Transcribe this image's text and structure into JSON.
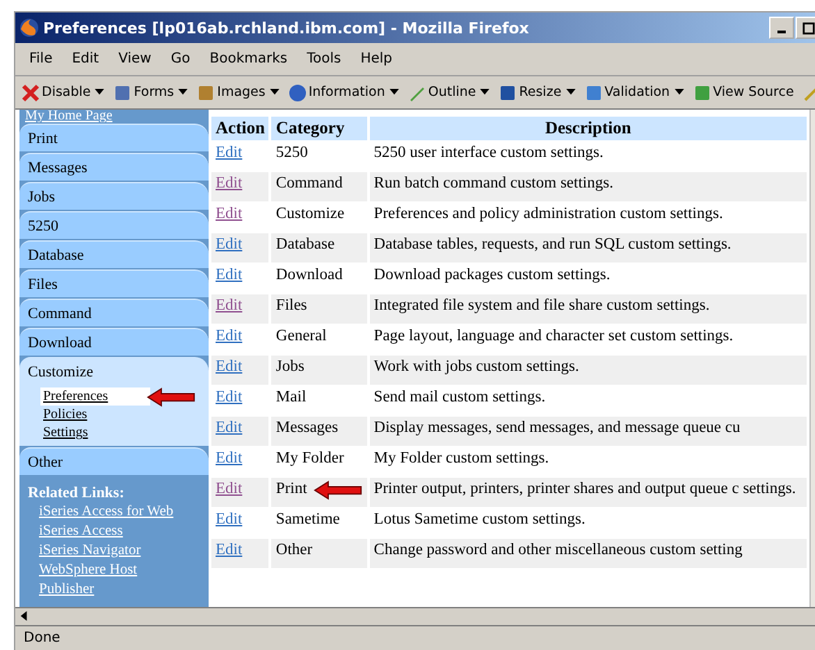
{
  "window": {
    "title": "Preferences [lp016ab.rchland.ibm.com] - Mozilla Firefox"
  },
  "menu": [
    "File",
    "Edit",
    "View",
    "Go",
    "Bookmarks",
    "Tools",
    "Help"
  ],
  "toolbar": [
    {
      "label": "Disable",
      "has_menu": true,
      "kind": "disable"
    },
    {
      "label": "Forms",
      "has_menu": true,
      "kind": "forms"
    },
    {
      "label": "Images",
      "has_menu": true,
      "kind": "images"
    },
    {
      "label": "Information",
      "has_menu": true,
      "kind": "info"
    },
    {
      "label": "Outline",
      "has_menu": true,
      "kind": "outline"
    },
    {
      "label": "Resize",
      "has_menu": true,
      "kind": "resize"
    },
    {
      "label": "Validation",
      "has_menu": true,
      "kind": "validation"
    },
    {
      "label": "View Source",
      "has_menu": false,
      "kind": "source"
    }
  ],
  "sidebar": {
    "home_link": "My Home Page",
    "tabs": [
      {
        "label": "Print",
        "selected": false
      },
      {
        "label": "Messages",
        "selected": false
      },
      {
        "label": "Jobs",
        "selected": false
      },
      {
        "label": "5250",
        "selected": false
      },
      {
        "label": "Database",
        "selected": false
      },
      {
        "label": "Files",
        "selected": false
      },
      {
        "label": "Command",
        "selected": false
      },
      {
        "label": "Download",
        "selected": false
      },
      {
        "label": "Customize",
        "selected": true,
        "children": [
          {
            "label": "Preferences",
            "selected": true
          },
          {
            "label": "Policies",
            "selected": false
          },
          {
            "label": "Settings",
            "selected": false
          }
        ]
      },
      {
        "label": "Other",
        "selected": false
      }
    ],
    "related_heading": "Related Links:",
    "related_links": [
      "iSeries Access for Web",
      "iSeries Access",
      "iSeries Navigator",
      "WebSphere Host",
      "Publisher"
    ]
  },
  "table": {
    "columns": [
      "Action",
      "Category",
      "Description"
    ],
    "rows": [
      {
        "action": "Edit",
        "visited": false,
        "category": "5250",
        "description": "5250 user interface custom settings."
      },
      {
        "action": "Edit",
        "visited": true,
        "category": "Command",
        "description": "Run batch command custom settings."
      },
      {
        "action": "Edit",
        "visited": true,
        "category": "Customize",
        "description": "Preferences and policy administration custom settings."
      },
      {
        "action": "Edit",
        "visited": false,
        "category": "Database",
        "description": "Database tables, requests, and run SQL custom settings."
      },
      {
        "action": "Edit",
        "visited": false,
        "category": "Download",
        "description": "Download packages custom settings."
      },
      {
        "action": "Edit",
        "visited": true,
        "category": "Files",
        "description": "Integrated file system and file share custom settings."
      },
      {
        "action": "Edit",
        "visited": false,
        "category": "General",
        "description": "Page layout, language and character set custom settings."
      },
      {
        "action": "Edit",
        "visited": false,
        "category": "Jobs",
        "description": "Work with jobs custom settings."
      },
      {
        "action": "Edit",
        "visited": false,
        "category": "Mail",
        "description": "Send mail custom settings."
      },
      {
        "action": "Edit",
        "visited": false,
        "category": "Messages",
        "description": "Display messages, send messages, and message queue cu"
      },
      {
        "action": "Edit",
        "visited": false,
        "category": "My Folder",
        "description": "My Folder custom settings."
      },
      {
        "action": "Edit",
        "visited": true,
        "category": "Print",
        "description": "Printer output, printers, printer shares and output queue c settings.",
        "pointer": true
      },
      {
        "action": "Edit",
        "visited": false,
        "category": "Sametime",
        "description": "Lotus Sametime custom settings."
      },
      {
        "action": "Edit",
        "visited": false,
        "category": "Other",
        "description": "Change password and other miscellaneous custom setting"
      }
    ]
  },
  "status_bar": "Done"
}
